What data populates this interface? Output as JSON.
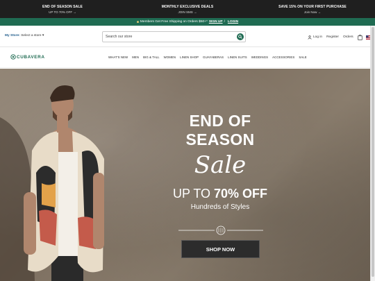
{
  "promo": [
    {
      "title": "END OF SEASON SALE",
      "sub": "UP TO 70% OFF →"
    },
    {
      "title": "MONTHLY EXCLUSIVE DEALS",
      "sub": "JOIN SMS →"
    },
    {
      "title": "SAVE 15% ON YOUR FIRST PURCHASE",
      "sub": "Join Now →"
    }
  ],
  "member": {
    "text": "Members Get Free Shipping on Orders $50+*",
    "signup": "SIGN UP",
    "sep": "/",
    "login": "LOGIN"
  },
  "store": {
    "label": "My Store:",
    "value": "Select a store ▾"
  },
  "search": {
    "placeholder": "Search our store"
  },
  "account": {
    "login": "Log in",
    "register": "Register",
    "orders": "Orders"
  },
  "logo": {
    "text": "CUBAVERA"
  },
  "nav": [
    "WHAT'S NEW",
    "MEN",
    "BIG & TALL",
    "WOMEN",
    "LINEN SHOP",
    "GUAYABERAS",
    "LINEN SUITS",
    "WEDDINGS",
    "ACCESSORIES",
    "SALE"
  ],
  "hero": {
    "line1": "END OF SEASON",
    "line2": "Sale",
    "line3_prefix": "UP TO ",
    "line3_bold": "70% OFF",
    "line4": "Hundreds of Styles",
    "cta": "SHOP NOW"
  },
  "colors": {
    "brand": "#1f6b52",
    "topbar": "#1f1f1f",
    "cta": "#2c2c2c"
  }
}
